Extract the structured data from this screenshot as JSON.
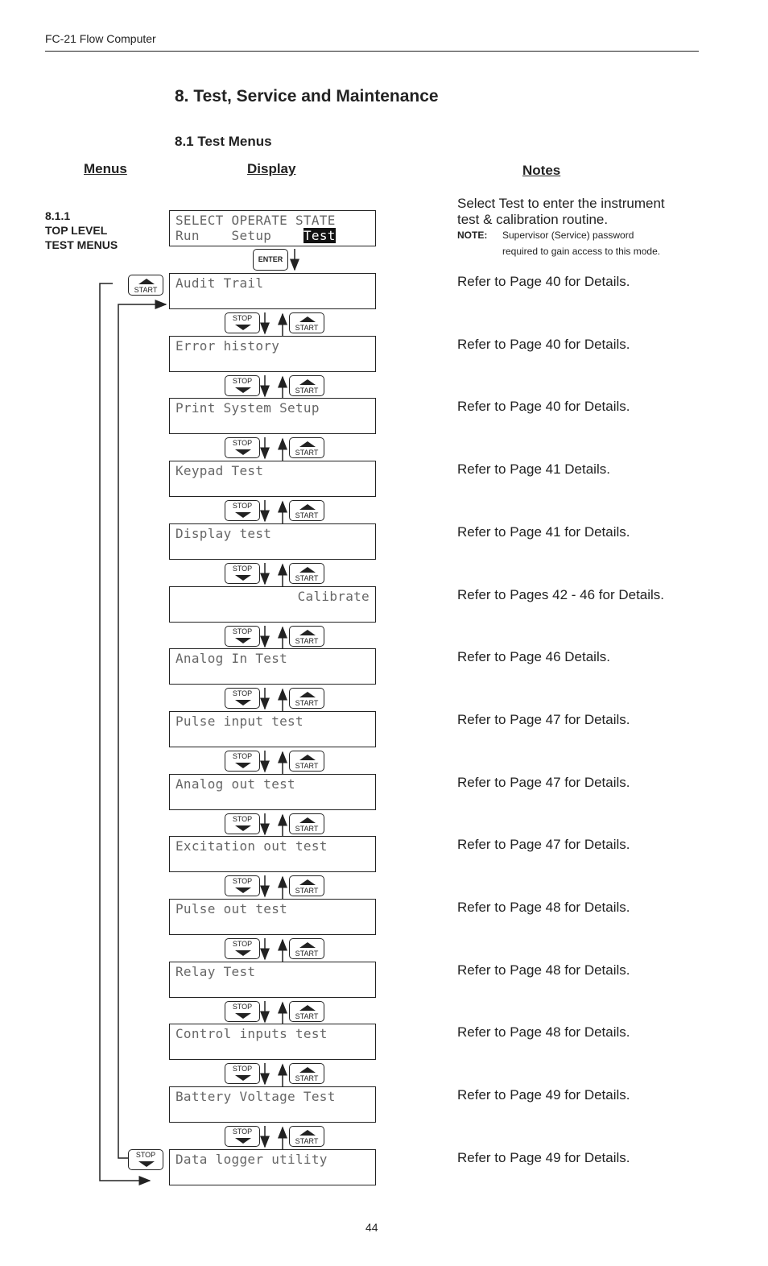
{
  "header": {
    "running_title": "FC-21 Flow Computer"
  },
  "title": "8. Test, Service and Maintenance",
  "subtitle": "8.1 Test Menus",
  "columns": {
    "menus": "Menus",
    "display": "Display",
    "notes": "Notes"
  },
  "section": {
    "number": "8.1.1",
    "line1": "TOP LEVEL",
    "line2": "TEST MENUS"
  },
  "top_display": {
    "line1": "SELECT OPERATE STATE",
    "line2_items": [
      "Run",
      "Setup",
      "Test"
    ],
    "selected": "Test"
  },
  "top_note": {
    "line1": "Select Test to enter the instrument",
    "line2": "test & calibration routine.",
    "note_label": "NOTE:",
    "note_line1": "Supervisor (Service) password",
    "note_line2": "required to gain access to this mode."
  },
  "keys": {
    "enter": "ENTER",
    "stop": "STOP",
    "start": "START"
  },
  "menus": [
    {
      "display": "Audit Trail",
      "align": "left",
      "note": "Refer to Page 40 for Details."
    },
    {
      "display": "Error history",
      "align": "left",
      "note": "Refer to Page 40 for Details."
    },
    {
      "display": "Print System Setup",
      "align": "left",
      "note": "Refer to Page 40 for Details."
    },
    {
      "display": "Keypad Test",
      "align": "left",
      "note": "Refer to Page 41 Details."
    },
    {
      "display": "Display test",
      "align": "left",
      "note": "Refer to Page 41 for Details."
    },
    {
      "display": "Calibrate",
      "align": "right",
      "note": "Refer to Pages 42 - 46 for Details."
    },
    {
      "display": "Analog In Test",
      "align": "left",
      "note": "Refer to Page 46 Details."
    },
    {
      "display": "Pulse input test",
      "align": "left",
      "note": "Refer to Page 47 for Details."
    },
    {
      "display": "Analog out test",
      "align": "left",
      "note": "Refer to Page 47 for Details."
    },
    {
      "display": "Excitation out test",
      "align": "left",
      "note": "Refer to Page 47 for Details."
    },
    {
      "display": "Pulse out test",
      "align": "left",
      "note": "Refer to Page 48 for Details."
    },
    {
      "display": "Relay Test",
      "align": "left",
      "note": "Refer to Page 48 for Details."
    },
    {
      "display": "Control inputs test",
      "align": "left",
      "note": "Refer to Page 48 for Details."
    },
    {
      "display": "Battery Voltage Test",
      "align": "left",
      "note": "Refer to Page 49 for Details."
    },
    {
      "display": "Data logger utility",
      "align": "left",
      "note": "Refer to Page 49 for Details."
    }
  ],
  "footer": {
    "page_number": "44"
  }
}
